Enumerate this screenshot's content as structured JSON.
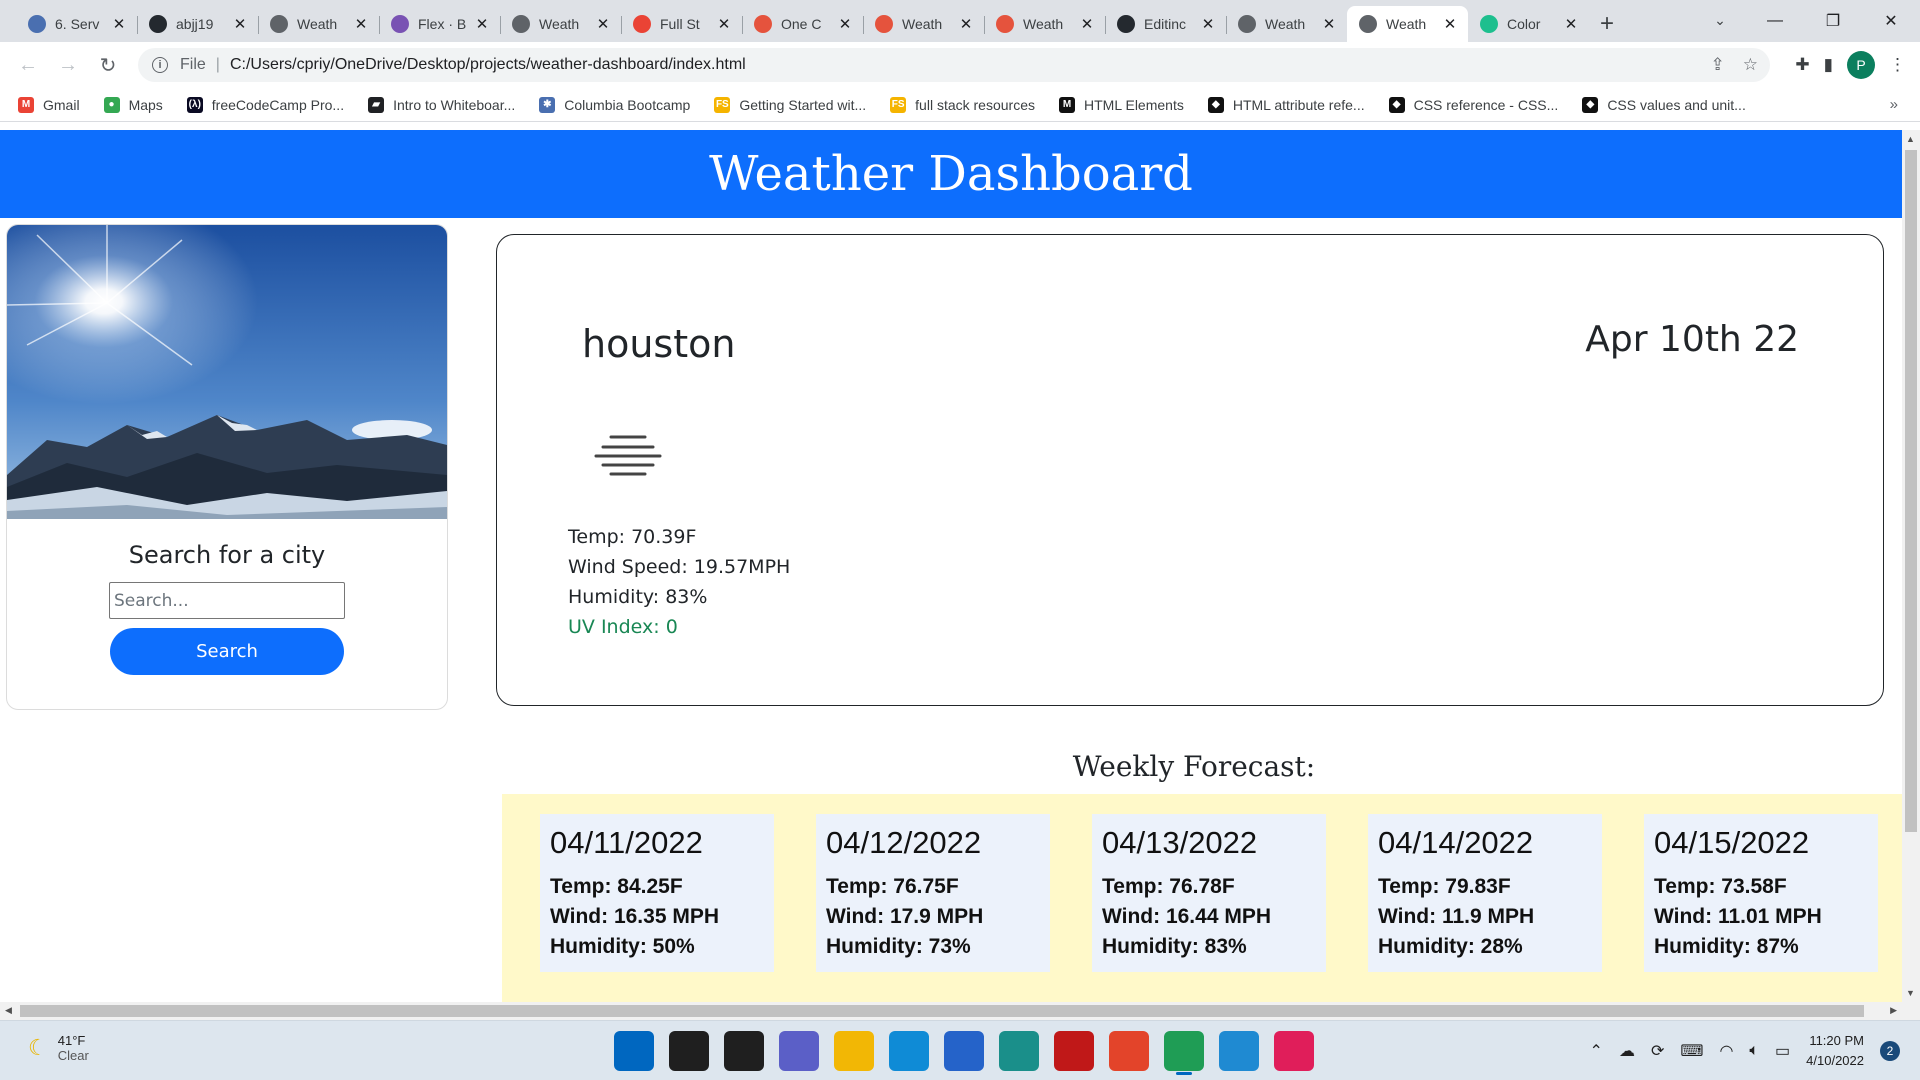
{
  "browser": {
    "tabs": [
      {
        "title": "6. Serv",
        "favicon": "columbia-icon",
        "color": "#4a6fb0"
      },
      {
        "title": "abjj19",
        "favicon": "github-icon",
        "color": "#24292f"
      },
      {
        "title": "Weath",
        "favicon": "globe-icon",
        "color": "#5f6368"
      },
      {
        "title": "Flex · B",
        "favicon": "bootstrap-icon",
        "color": "#7952b3"
      },
      {
        "title": "Weath",
        "favicon": "globe-icon",
        "color": "#5f6368"
      },
      {
        "title": "Full St",
        "favicon": "gmail-icon",
        "color": "#ea4335"
      },
      {
        "title": "One C",
        "favicon": "weather-app-icon",
        "color": "#e5533d"
      },
      {
        "title": "Weath",
        "favicon": "weather-app-icon",
        "color": "#e5533d"
      },
      {
        "title": "Weath",
        "favicon": "weather-app-icon",
        "color": "#e5533d"
      },
      {
        "title": "Editinc",
        "favicon": "github-icon",
        "color": "#24292f"
      },
      {
        "title": "Weath",
        "favicon": "globe-icon",
        "color": "#5f6368"
      },
      {
        "title": "Weath",
        "favicon": "globe-icon",
        "color": "#5f6368",
        "active": true
      },
      {
        "title": "Color",
        "favicon": "color-icon",
        "color": "#1dbf8e"
      }
    ],
    "address": {
      "scheme": "File",
      "url": "C:/Users/cpriy/OneDrive/Desktop/projects/weather-dashboard/index.html"
    },
    "profile_initial": "P",
    "bookmarks": [
      {
        "label": "Gmail",
        "icon": "gmail-icon",
        "color": "#ea4335",
        "glyph": "M"
      },
      {
        "label": "Maps",
        "icon": "maps-icon",
        "color": "#34a853",
        "glyph": "●"
      },
      {
        "label": "freeCodeCamp Pro...",
        "icon": "freecodecamp-icon",
        "color": "#0a0a23",
        "glyph": "(λ)"
      },
      {
        "label": "Intro to Whiteboar...",
        "icon": "notebook-icon",
        "color": "#202124",
        "glyph": "▰"
      },
      {
        "label": "Columbia Bootcamp",
        "icon": "columbia-icon",
        "color": "#4a6fb0",
        "glyph": "✱"
      },
      {
        "label": "Getting Started wit...",
        "icon": "fullstack-icon",
        "color": "#f5b400",
        "glyph": "FS"
      },
      {
        "label": "full stack resources",
        "icon": "fullstack-icon",
        "color": "#f5b400",
        "glyph": "FS"
      },
      {
        "label": "HTML Elements",
        "icon": "mdn-icon",
        "color": "#111111",
        "glyph": "M"
      },
      {
        "label": "HTML attribute refe...",
        "icon": "w3-icon",
        "color": "#111111",
        "glyph": "◆"
      },
      {
        "label": "CSS reference - CSS...",
        "icon": "w3-icon",
        "color": "#111111",
        "glyph": "◆"
      },
      {
        "label": "CSS values and unit...",
        "icon": "w3-icon",
        "color": "#111111",
        "glyph": "◆"
      }
    ]
  },
  "page": {
    "header_title": "Weather Dashboard",
    "sidebar": {
      "heading": "Search for a city",
      "search_placeholder": "Search...",
      "search_button": "Search"
    },
    "current": {
      "city": "houston",
      "date": "Apr 10th 22",
      "icon": "haze-icon",
      "temp": "Temp: 70.39F",
      "wind": "Wind Speed: 19.57MPH",
      "humidity": "Humidity: 83%",
      "uv": "UV Index: 0"
    },
    "forecast_title": "Weekly Forecast:",
    "forecast": [
      {
        "date": "04/11/2022",
        "temp": "Temp: 84.25F",
        "wind": "Wind: 16.35 MPH",
        "humidity": "Humidity: 50%"
      },
      {
        "date": "04/12/2022",
        "temp": "Temp: 76.75F",
        "wind": "Wind: 17.9 MPH",
        "humidity": "Humidity: 73%"
      },
      {
        "date": "04/13/2022",
        "temp": "Temp: 76.78F",
        "wind": "Wind: 16.44 MPH",
        "humidity": "Humidity: 83%"
      },
      {
        "date": "04/14/2022",
        "temp": "Temp: 79.83F",
        "wind": "Wind: 11.9 MPH",
        "humidity": "Humidity: 28%"
      },
      {
        "date": "04/15/2022",
        "temp": "Temp: 73.58F",
        "wind": "Wind: 11.01 MPH",
        "humidity": "Humidity: 87%"
      }
    ]
  },
  "taskbar": {
    "weather_temp": "41°F",
    "weather_desc": "Clear",
    "time": "11:20 PM",
    "date": "4/10/2022",
    "notifications": "2",
    "apps": [
      {
        "name": "start-icon",
        "color": "#0067c0"
      },
      {
        "name": "search-icon",
        "color": "#1f1f1f"
      },
      {
        "name": "task-view-icon",
        "color": "#1f1f1f"
      },
      {
        "name": "chat-icon",
        "color": "#5b5fc7"
      },
      {
        "name": "file-explorer-icon",
        "color": "#f2b705"
      },
      {
        "name": "edge-icon",
        "color": "#0f8bd6"
      },
      {
        "name": "store-icon",
        "color": "#2563c9"
      },
      {
        "name": "app-icon",
        "color": "#1a8f8a"
      },
      {
        "name": "mcafee-icon",
        "color": "#c01818"
      },
      {
        "name": "office-icon",
        "color": "#e3442a"
      },
      {
        "name": "chrome-icon",
        "color": "#1f9d55",
        "active": true
      },
      {
        "name": "vscode-icon",
        "color": "#1f8ad2"
      },
      {
        "name": "slack-icon",
        "color": "#e01e5a"
      }
    ]
  }
}
